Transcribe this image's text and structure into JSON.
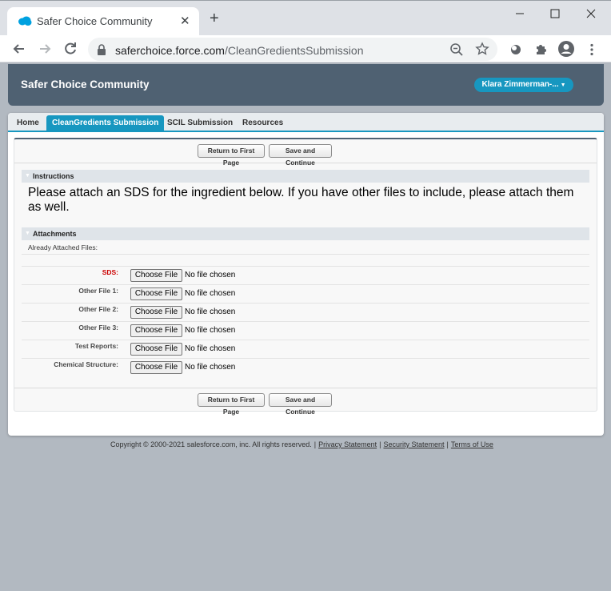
{
  "browser": {
    "tab_title": "Safer Choice Community",
    "url_domain": "saferchoice.force.com",
    "url_path": "/CleanGredientsSubmission"
  },
  "header": {
    "site_title": "Safer Choice Community",
    "user_menu": "Klara Zimmerman-..."
  },
  "nav": {
    "tabs": [
      {
        "label": "Home"
      },
      {
        "label": "CleanGredients Submission",
        "active": true
      },
      {
        "label": "SCIL Submission"
      },
      {
        "label": "Resources"
      }
    ]
  },
  "buttons": {
    "return_first": "Return to First Page",
    "save_continue": "Save and Continue"
  },
  "instructions": {
    "heading": "Instructions",
    "text": "Please attach an SDS for the ingredient below. If you have other files to include, please attach them as well."
  },
  "attachments": {
    "heading": "Attachments",
    "already_attached": "Already Attached Files:",
    "choose_file": "Choose File",
    "no_file": "No file chosen",
    "fields": [
      {
        "label": "SDS:",
        "required": true
      },
      {
        "label": "Other File 1:"
      },
      {
        "label": "Other File 2:"
      },
      {
        "label": "Other File 3:"
      },
      {
        "label": "Test Reports:"
      },
      {
        "label": "Chemical Structure:"
      }
    ]
  },
  "footer": {
    "copyright": "Copyright © 2000-2021 salesforce.com, inc. All rights reserved.",
    "links": [
      "Privacy Statement",
      "Security Statement",
      "Terms of Use"
    ]
  },
  "colors": {
    "header_bg": "#4f6172",
    "accent": "#1797c0",
    "required": "#cc0000"
  }
}
